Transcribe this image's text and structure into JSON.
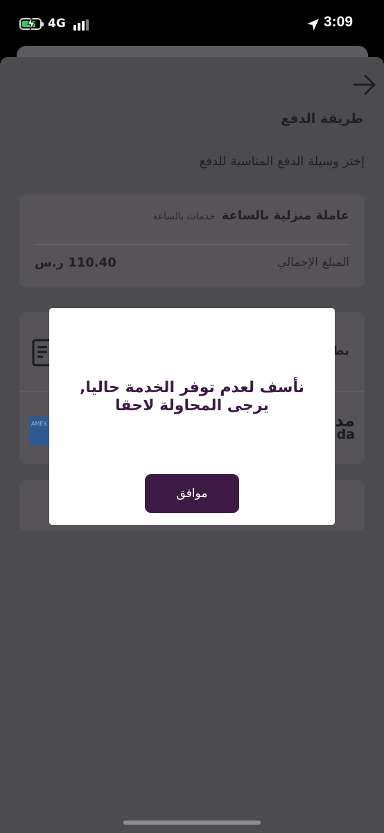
{
  "status_bar": {
    "network": "4G",
    "time": "3:09",
    "battery_level": 0.8
  },
  "header": {
    "back_icon": "arrow-right-icon"
  },
  "page": {
    "title": "طريقة الدفع",
    "subtitle": "إختر وسيلة الدفع المناسبة للدفع"
  },
  "summary": {
    "service_name": "عاملة منزلية بالساعة",
    "service_type": "خدمات بالساعة",
    "total_label": "المبلغ الإجمالي",
    "total_value": "110.40 ر.س"
  },
  "payment_methods": {
    "first_method_label_partial": "بط",
    "amex_text": "AMEX",
    "mada_ar": "مد",
    "mada_en": "da"
  },
  "dialog": {
    "message": "نأسف لعدم توفر الخدمة حاليا, يرجى المحاولة لاحقا",
    "ok_label": "موافق"
  },
  "colors": {
    "accent": "#3d1a46",
    "overlay": "#4c4b4e",
    "dialog_bg": "#ffffff"
  }
}
